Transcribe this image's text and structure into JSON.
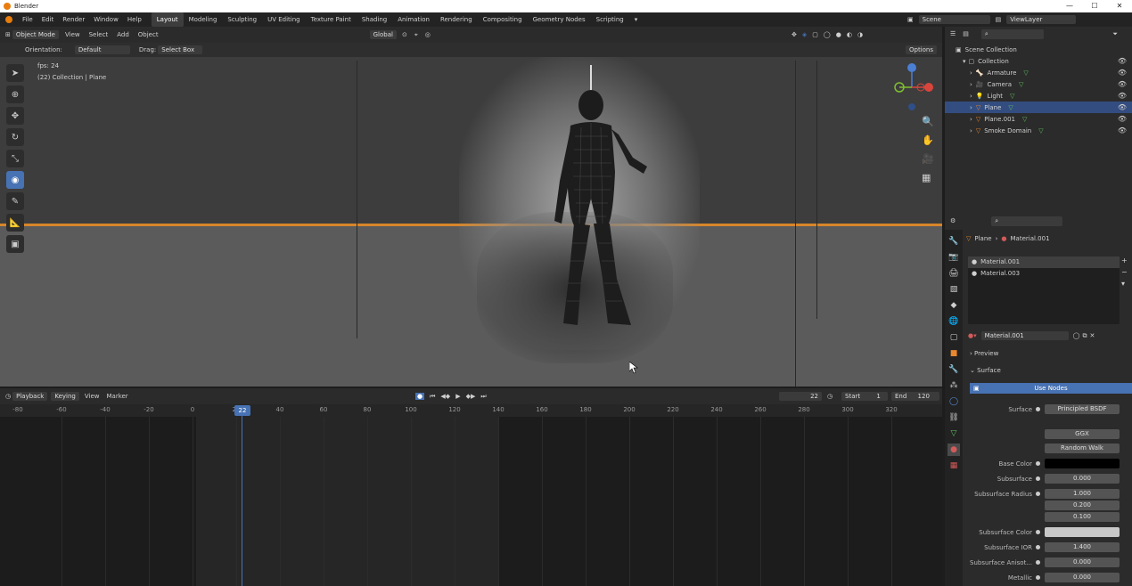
{
  "app": {
    "title": "Blender"
  },
  "window_controls": {
    "minimize": "—",
    "maximize": "☐",
    "close": "✕"
  },
  "menu": [
    "File",
    "Edit",
    "Render",
    "Window",
    "Help"
  ],
  "workspaces": [
    "Layout",
    "Modeling",
    "Sculpting",
    "UV Editing",
    "Texture Paint",
    "Shading",
    "Animation",
    "Rendering",
    "Compositing",
    "Geometry Nodes",
    "Scripting"
  ],
  "scene": {
    "scene_name": "Scene",
    "view_layer": "ViewLayer"
  },
  "viewport_header": {
    "mode": "Object Mode",
    "menus": [
      "View",
      "Select",
      "Add",
      "Object"
    ],
    "transform": "Global",
    "orientation_label": "Orientation:",
    "orientation_value": "Default",
    "drag_label": "Drag:",
    "drag_value": "Select Box",
    "options": "Options"
  },
  "viewport_overlay": {
    "fps": "fps: 24",
    "collection": "(22) Collection | Plane"
  },
  "timeline": {
    "menus": [
      "Playback",
      "Keying",
      "View",
      "Marker"
    ],
    "current_frame": "22",
    "start_label": "Start",
    "start": "1",
    "end_label": "End",
    "end": "120",
    "ticks": [
      "-60",
      "-40",
      "-20",
      "0",
      "20",
      "40",
      "60",
      "80",
      "100",
      "120",
      "140",
      "160",
      "180",
      "200",
      "220",
      "240",
      "260",
      "280",
      "300",
      "320"
    ],
    "leading_tick": "-80"
  },
  "outliner": {
    "root": "Scene Collection",
    "collection": "Collection",
    "items": [
      {
        "name": "Armature",
        "selected": false
      },
      {
        "name": "Camera",
        "selected": false
      },
      {
        "name": "Light",
        "selected": false
      },
      {
        "name": "Plane",
        "selected": true
      },
      {
        "name": "Plane.001",
        "selected": false
      },
      {
        "name": "Smoke Domain",
        "selected": false
      }
    ]
  },
  "properties": {
    "breadcrumb": [
      "Plane",
      "Material.001"
    ],
    "slots": [
      "Material.001",
      "Material.003"
    ],
    "material_name": "Material.001",
    "panels": {
      "preview": "Preview",
      "surface": "Surface"
    },
    "use_nodes": "Use Nodes",
    "rows": [
      {
        "label": "Surface",
        "value": "Principled BSDF"
      },
      {
        "label": "",
        "value": "GGX"
      },
      {
        "label": "",
        "value": "Random Walk"
      },
      {
        "label": "Base Color",
        "value": ""
      },
      {
        "label": "Subsurface",
        "value": "0.000"
      },
      {
        "label": "Subsurface Radius",
        "value": "1.000"
      },
      {
        "label": "",
        "value": "0.200"
      },
      {
        "label": "",
        "value": "0.100"
      },
      {
        "label": "Subsurface Color",
        "value": ""
      },
      {
        "label": "Subsurface IOR",
        "value": "1.400"
      },
      {
        "label": "Subsurface Anisot...",
        "value": "0.000"
      },
      {
        "label": "Metallic",
        "value": "0.000"
      }
    ]
  },
  "colors": {
    "accent": "#4772b3",
    "horizon": "#d7862a",
    "selected_row": "#334d80"
  }
}
